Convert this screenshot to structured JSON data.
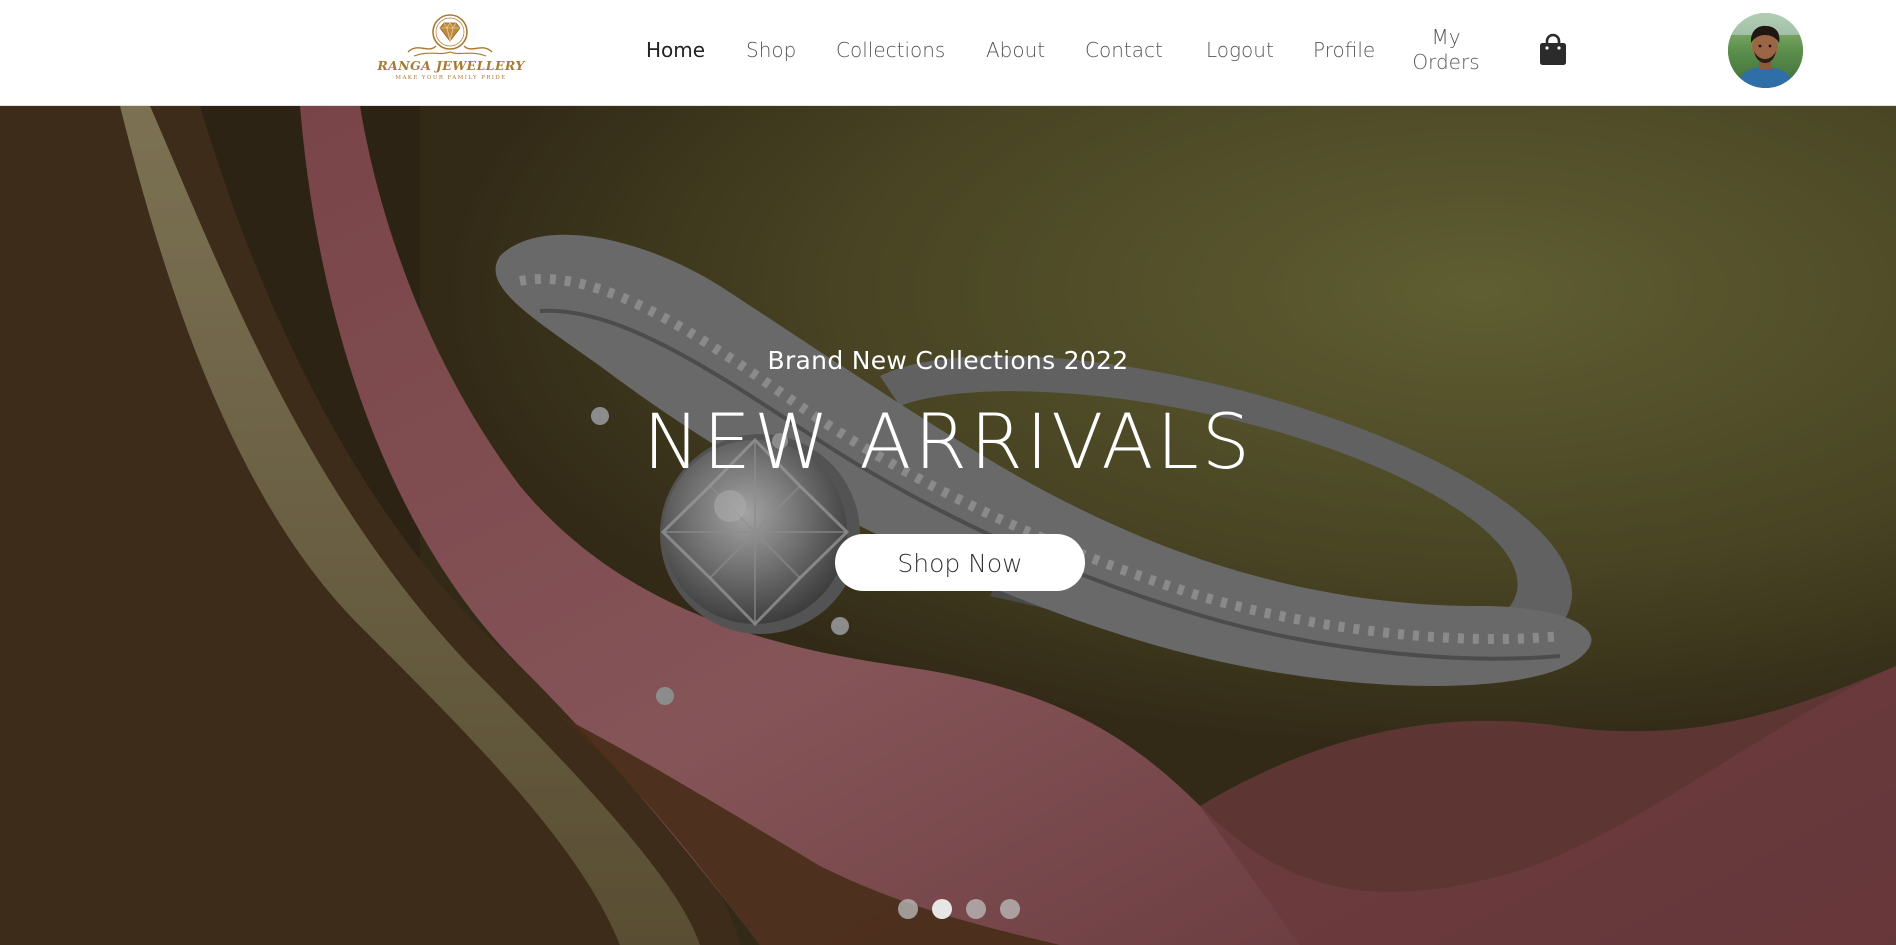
{
  "brand": {
    "name": "RANGA JEWELLERY",
    "tagline": "MAKE YOUR FAMILY PRIDE",
    "color": "#a87a35"
  },
  "nav": {
    "items": [
      {
        "label": "Home",
        "active": true
      },
      {
        "label": "Shop"
      },
      {
        "label": "Collections"
      },
      {
        "label": "About"
      },
      {
        "label": "Contact"
      },
      {
        "label": "Logout"
      },
      {
        "label": "Profile"
      },
      {
        "label": "My Orders"
      }
    ],
    "cart_icon": "shopping-bag-icon",
    "avatar_icon": "user-avatar"
  },
  "hero": {
    "subtitle": "Brand New Collections 2022",
    "title": "NEW ARRIVALS",
    "cta_label": "Shop Now",
    "slide_count": 4,
    "active_slide": 1
  }
}
